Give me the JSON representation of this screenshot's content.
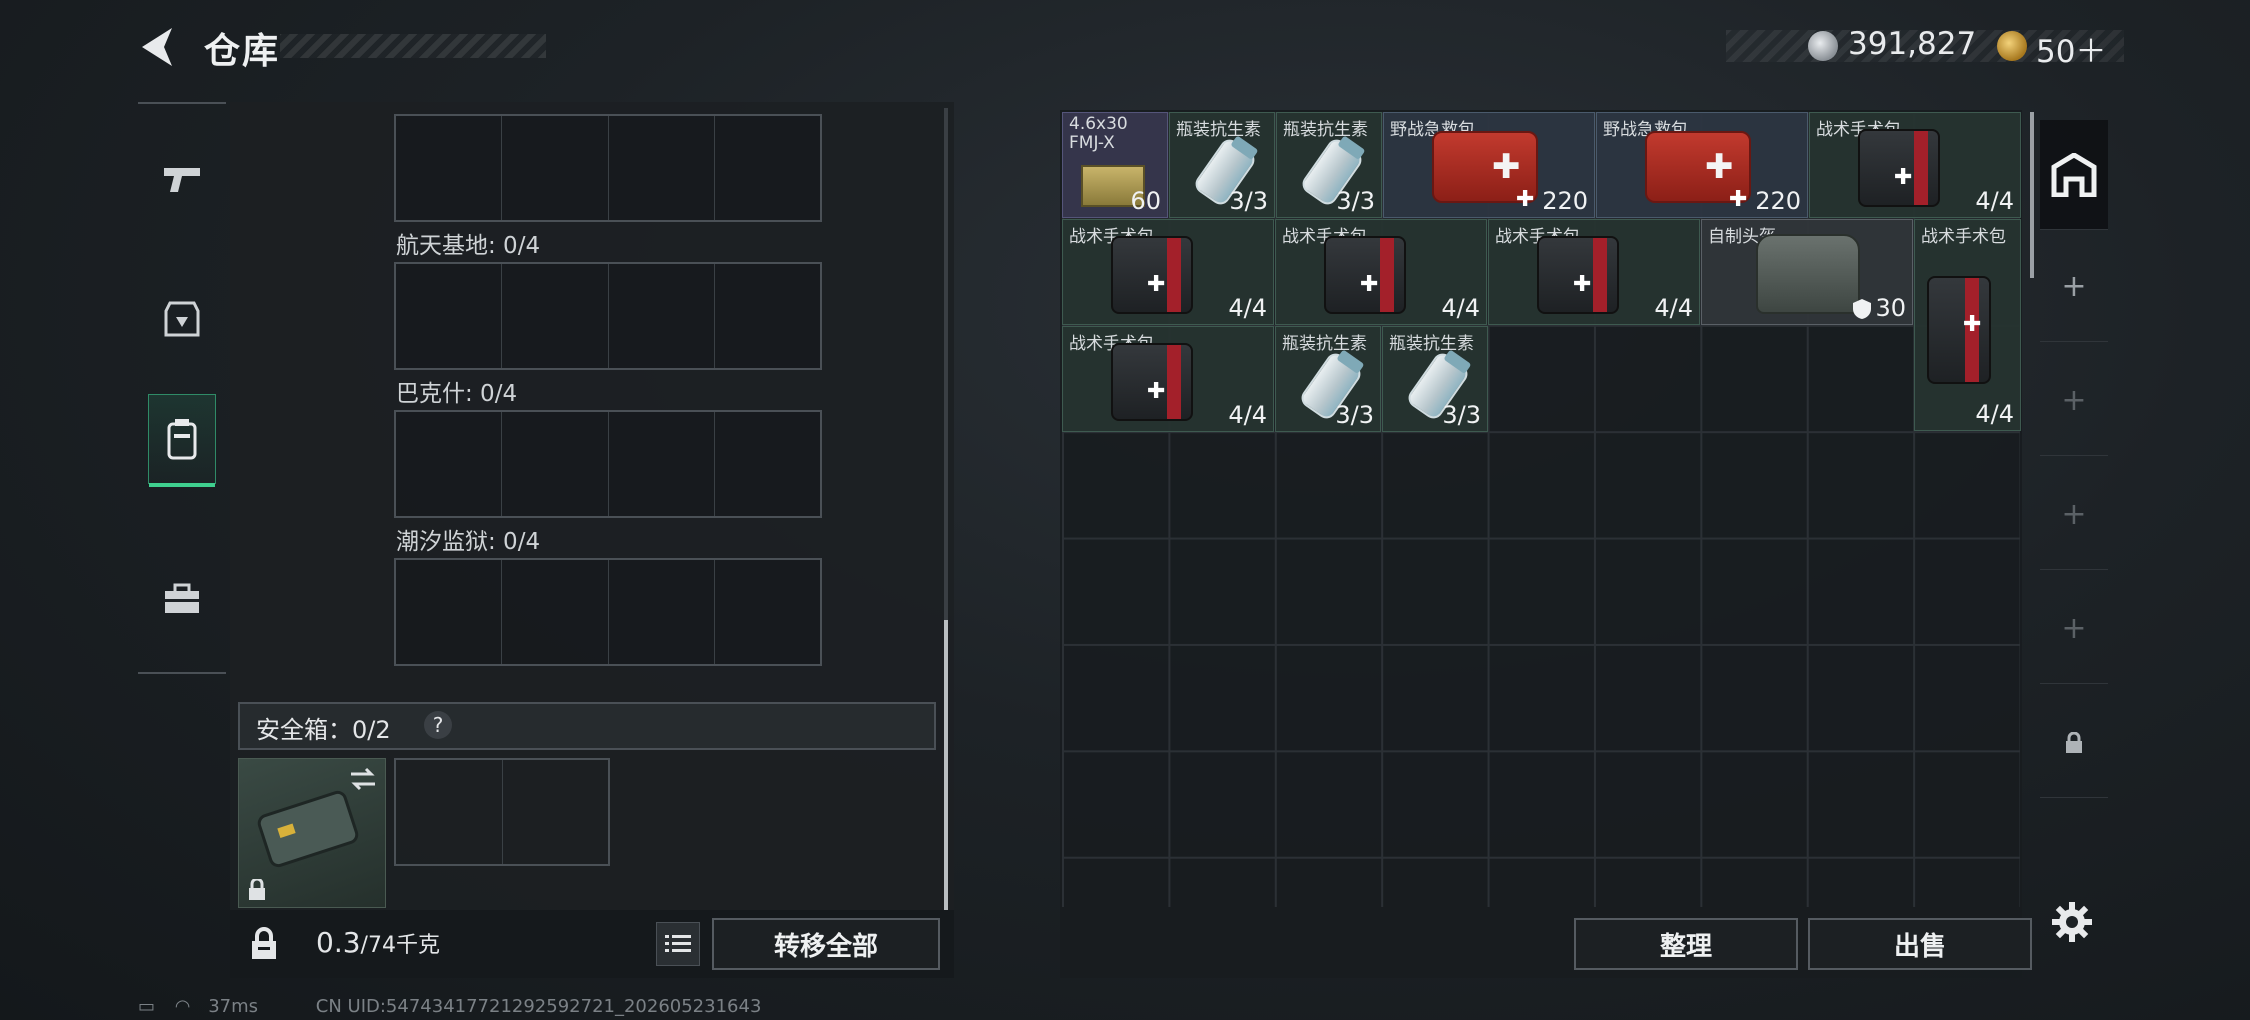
{
  "header": {
    "title": "仓库"
  },
  "currency": {
    "silver": "391,827",
    "gold": "50＋"
  },
  "left_tabs": [
    "pistol-icon",
    "armor-icon",
    "backpack-icon",
    "toolbox-icon"
  ],
  "containers": {
    "maps": [
      {
        "label": "航天基地: 0/4"
      },
      {
        "label": "巴克什: 0/4"
      },
      {
        "label": "潮汐监狱: 0/4"
      }
    ],
    "safe_box": {
      "label": "安全箱：0/2",
      "help": "?"
    }
  },
  "footer_left": {
    "weight_current": "0.3",
    "weight_max": "/74千克",
    "transfer_all": "转移全部"
  },
  "items": [
    {
      "name": "4.6x30 FMJ-X",
      "count": "60"
    },
    {
      "name": "瓶装抗生素",
      "count": "3/3"
    },
    {
      "name": "瓶装抗生素",
      "count": "3/3"
    },
    {
      "name": "野战急救包",
      "count": "220"
    },
    {
      "name": "野战急救包",
      "count": "220"
    },
    {
      "name": "战术手术包",
      "count": "4/4"
    },
    {
      "name": "战术手术包",
      "count": "4/4"
    },
    {
      "name": "战术手术包",
      "count": "4/4"
    },
    {
      "name": "战术手术包",
      "count": "4/4"
    },
    {
      "name": "自制头盔",
      "count": "30"
    },
    {
      "name": "战术手术包",
      "count": "4/4"
    },
    {
      "name": "战术手术包",
      "count": "4/4"
    },
    {
      "name": "瓶装抗生素",
      "count": "3/3"
    },
    {
      "name": "瓶装抗生素",
      "count": "3/3"
    }
  ],
  "right_tabs": [
    "inventory-icon",
    "+",
    "+",
    "+",
    "+",
    "lock-icon"
  ],
  "footer_right": {
    "sort": "整理",
    "sell": "出售"
  },
  "status": {
    "ping": "37ms",
    "uid": "CN UID:5474341772129259272​1_202605231643"
  },
  "colors": {
    "accent": "#3fd08f",
    "med_red": "#c23a2e"
  }
}
